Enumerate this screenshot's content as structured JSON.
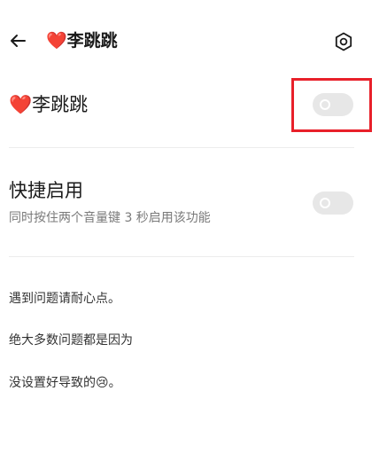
{
  "header": {
    "back_icon": "arrow-left-icon",
    "title": "❤️李跳跳",
    "settings_icon": "hexagon-gear-icon"
  },
  "main_toggle": {
    "label": "❤️李跳跳",
    "state": "off",
    "highlight_color": "#e8202a"
  },
  "quick_enable": {
    "title": "快捷启用",
    "description": "同时按住两个音量键 3 秒启用该功能",
    "state": "off"
  },
  "notes": [
    "遇到问题请耐心点。",
    "绝大多数问题都是因为",
    "没设置好导致的😢。"
  ],
  "colors": {
    "toggle_off_track": "#e7e7e7",
    "text_primary": "#1a1a1a",
    "text_secondary": "#7a7a7a"
  }
}
